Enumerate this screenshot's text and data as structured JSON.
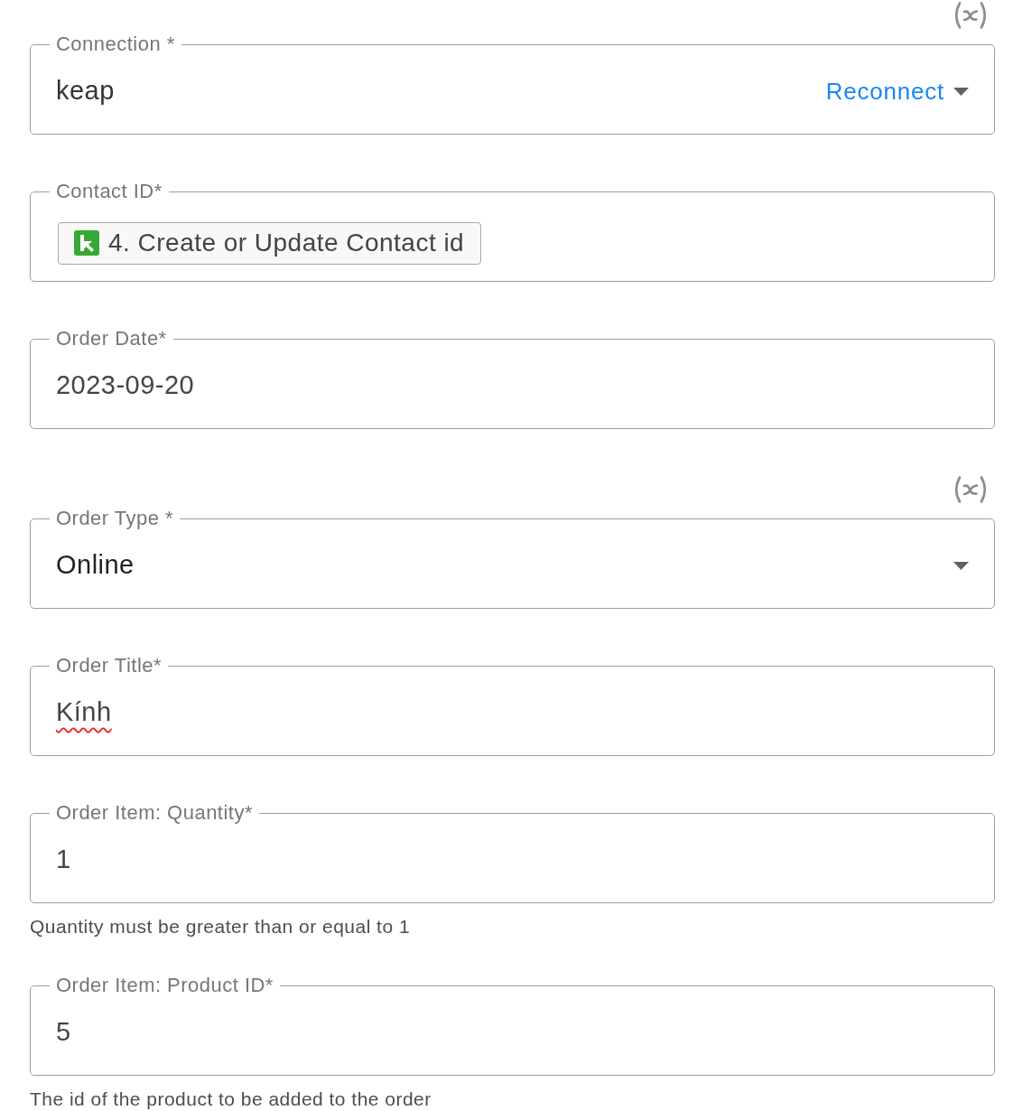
{
  "fields": [
    {
      "kind": "connection",
      "label": "Connection *",
      "value": "keap",
      "action": "Reconnect",
      "variable_toggle": true
    },
    {
      "kind": "token",
      "label": "Contact ID*",
      "token": "4. Create or Update Contact id"
    },
    {
      "kind": "text",
      "label": "Order Date*",
      "value": "2023-09-20"
    },
    {
      "kind": "select",
      "label": "Order Type *",
      "value": "Online",
      "variable_toggle": true
    },
    {
      "kind": "text",
      "label": "Order Title*",
      "value": "Kính",
      "spelling_error": true
    },
    {
      "kind": "text",
      "label": "Order Item: Quantity*",
      "value": "1",
      "help": "Quantity must be greater than or equal to 1"
    },
    {
      "kind": "text",
      "label": "Order Item: Product ID*",
      "value": "5",
      "help": "The id of the product to be added to the order"
    }
  ]
}
